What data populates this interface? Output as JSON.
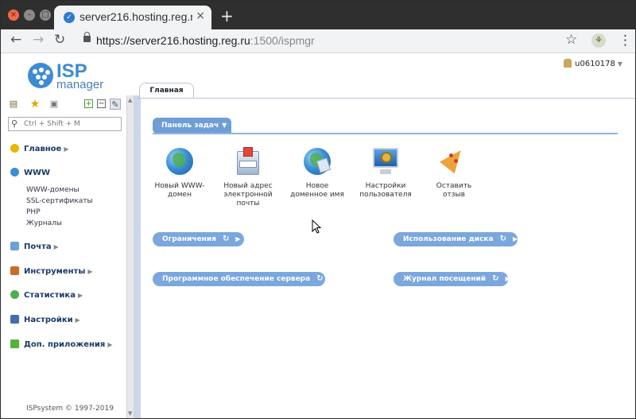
{
  "browser": {
    "tab_title": "server216.hosting.reg.ru",
    "url_main": "https://server216.hosting.reg.ru",
    "url_dim": ":1500/ispmgr",
    "new_tab": "+",
    "tab_close": "×"
  },
  "isp": {
    "logo_isp": "ISP",
    "logo_manager": "manager",
    "user": "u0610178",
    "tab_label": "Главная",
    "search_placeholder": "Ctrl + Shift + M",
    "footer": "ISPsystem © 1997-2019"
  },
  "sidebar": {
    "items": [
      {
        "label": "Главное",
        "icon": "home-icon",
        "color": "#e6b800"
      },
      {
        "label": "WWW",
        "icon": "globe-icon",
        "color": "#3a8fd6"
      },
      {
        "label": "Почта",
        "icon": "mail-icon",
        "color": "#6aa2d8"
      },
      {
        "label": "Инструменты",
        "icon": "tools-icon",
        "color": "#c96b2a"
      },
      {
        "label": "Статистика",
        "icon": "stats-icon",
        "color": "#4caf50"
      },
      {
        "label": "Настройки",
        "icon": "settings-icon",
        "color": "#3f6fb0"
      },
      {
        "label": "Доп. приложения",
        "icon": "plus-icon",
        "color": "#55b33a"
      }
    ],
    "www_sub": [
      "WWW-домены",
      "SSL-сертификаты",
      "PHP",
      "Журналы"
    ]
  },
  "dashboard": {
    "panel_title": "Панель задач",
    "tasks": [
      {
        "label_1": "Новый WWW-",
        "label_2": "домен",
        "label_3": "",
        "icon": "globe-icon"
      },
      {
        "label_1": "Новый адрес",
        "label_2": "электронной",
        "label_3": "почты",
        "icon": "mail-box-icon"
      },
      {
        "label_1": "Новое",
        "label_2": "доменное имя",
        "label_3": "",
        "icon": "globe-domain-icon"
      },
      {
        "label_1": "Настройки",
        "label_2": "пользователя",
        "label_3": "",
        "icon": "monitor-gear-icon"
      },
      {
        "label_1": "Оставить",
        "label_2": "отзыв",
        "label_3": "",
        "icon": "pizza-icon"
      }
    ],
    "widgets": [
      "Ограничения",
      "Использование диска",
      "Программное обеспечение сервера",
      "Журнал посещений"
    ]
  }
}
